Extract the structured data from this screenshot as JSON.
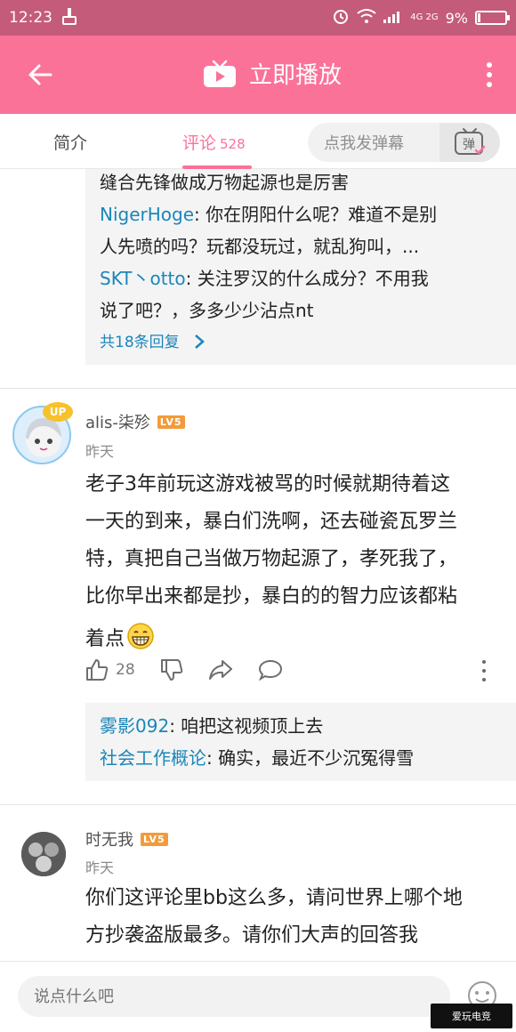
{
  "status_bar": {
    "time": "12:23",
    "network": "4G 2G",
    "battery": "9%",
    "battery_level": 0.09
  },
  "header": {
    "title": "立即播放"
  },
  "tabs": {
    "intro": "简介",
    "comments": "评论",
    "comments_count": "528",
    "danmaku_placeholder": "点我发弹幕",
    "danmaku_icon_label": "弹"
  },
  "top_replies": {
    "lines": [
      {
        "user": "",
        "text": "缝合先锋做成万物起源也是厉害"
      },
      {
        "user": "NigerHoge",
        "text": ": 你在阴阳什么呢？难道不是别"
      },
      {
        "user": "",
        "text": "人先喷的吗？玩都没玩过，就乱狗叫，..."
      },
      {
        "user": "SKT丶otto",
        "text": ": 关注罗汉的什么成分？不用我"
      },
      {
        "user": "",
        "text": "说了吧？，多多少少沾点nt"
      }
    ],
    "more": "共18条回复"
  },
  "comments": [
    {
      "user": "alis-柒殄",
      "level": "LV5",
      "time": "昨天",
      "text_lines": [
        "老子3年前玩这游戏被骂的时候就期待着这",
        "一天的到来，暴白们洗啊，还去碰瓷瓦罗兰",
        "特，真把自己当做万物起源了，孝死我了，",
        "比你早出来都是抄，暴白的的智力应该都粘",
        "着点"
      ],
      "likes": "28",
      "replies": [
        {
          "user": "雾影092",
          "text": ": 咱把这视频顶上去"
        },
        {
          "user": "社会工作概论",
          "text": ": 确实，最近不少沉冤得雪"
        }
      ]
    },
    {
      "user": "时无我",
      "level": "LV5",
      "time": "昨天",
      "text_lines": [
        "你们这评论里bb这么多，请问世界上哪个地",
        "方抄袭盗版最多。请你们大声的回答我"
      ]
    }
  ],
  "bottom": {
    "input_placeholder": "说点什么吧"
  },
  "watermark": {
    "text": "爱玩电竞"
  },
  "colors": {
    "accent": "#fb7299",
    "link": "#1b86b9",
    "status_bar": "#c45b7b",
    "level_badge": "#f39b3a"
  }
}
